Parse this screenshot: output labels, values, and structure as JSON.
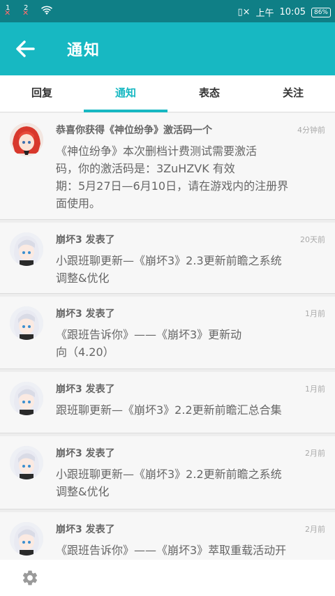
{
  "status_bar": {
    "sim1_label": "1",
    "sim2_label": "2",
    "vibrate_label": "▯×",
    "ampm": "上午",
    "time": "10:05",
    "battery": "86%"
  },
  "app_bar": {
    "title": "通知"
  },
  "tabs": [
    {
      "label": "回复",
      "active": false
    },
    {
      "label": "通知",
      "active": true
    },
    {
      "label": "表态",
      "active": false
    },
    {
      "label": "关注",
      "active": false
    }
  ],
  "notifications": [
    {
      "avatar": "red-hair-character",
      "title": "恭喜你获得《神位纷争》激活码一个",
      "time": "4分钟前",
      "body_lines": [
        "《神位纷争》本次删档计费测试需要激活",
        "码，你的激活码是：3ZuHZVK 有效",
        "期：5月27日—6月10日，请在游戏内的注册界",
        "面使用。"
      ]
    },
    {
      "avatar": "white-hair-character",
      "title": "崩坏3 发表了",
      "time": "20天前",
      "body_lines": [
        "小跟班聊更新—《崩坏3》2.3更新前瞻之系统",
        "调整&优化"
      ]
    },
    {
      "avatar": "white-hair-character",
      "title": "崩坏3 发表了",
      "time": "1月前",
      "body_lines": [
        "《跟班告诉你》——《崩坏3》更新动",
        "向（4.20）"
      ]
    },
    {
      "avatar": "white-hair-character",
      "title": "崩坏3 发表了",
      "time": "1月前",
      "body_lines": [
        "跟班聊更新—《崩坏3》2.2更新前瞻汇总合集"
      ]
    },
    {
      "avatar": "white-hair-character",
      "title": "崩坏3 发表了",
      "time": "2月前",
      "body_lines": [
        "小跟班聊更新—《崩坏3》2.2更新前瞻之系统",
        "调整&优化"
      ]
    },
    {
      "avatar": "white-hair-character",
      "title": "崩坏3 发表了",
      "time": "2月前",
      "body_lines": [
        "《跟班告诉你》——《崩坏3》萃取重载活动开"
      ]
    }
  ],
  "bottom_bar": {
    "icon": "gear-icon"
  },
  "colors": {
    "accent": "#17b8c2",
    "status_bar": "#0f7f86"
  }
}
